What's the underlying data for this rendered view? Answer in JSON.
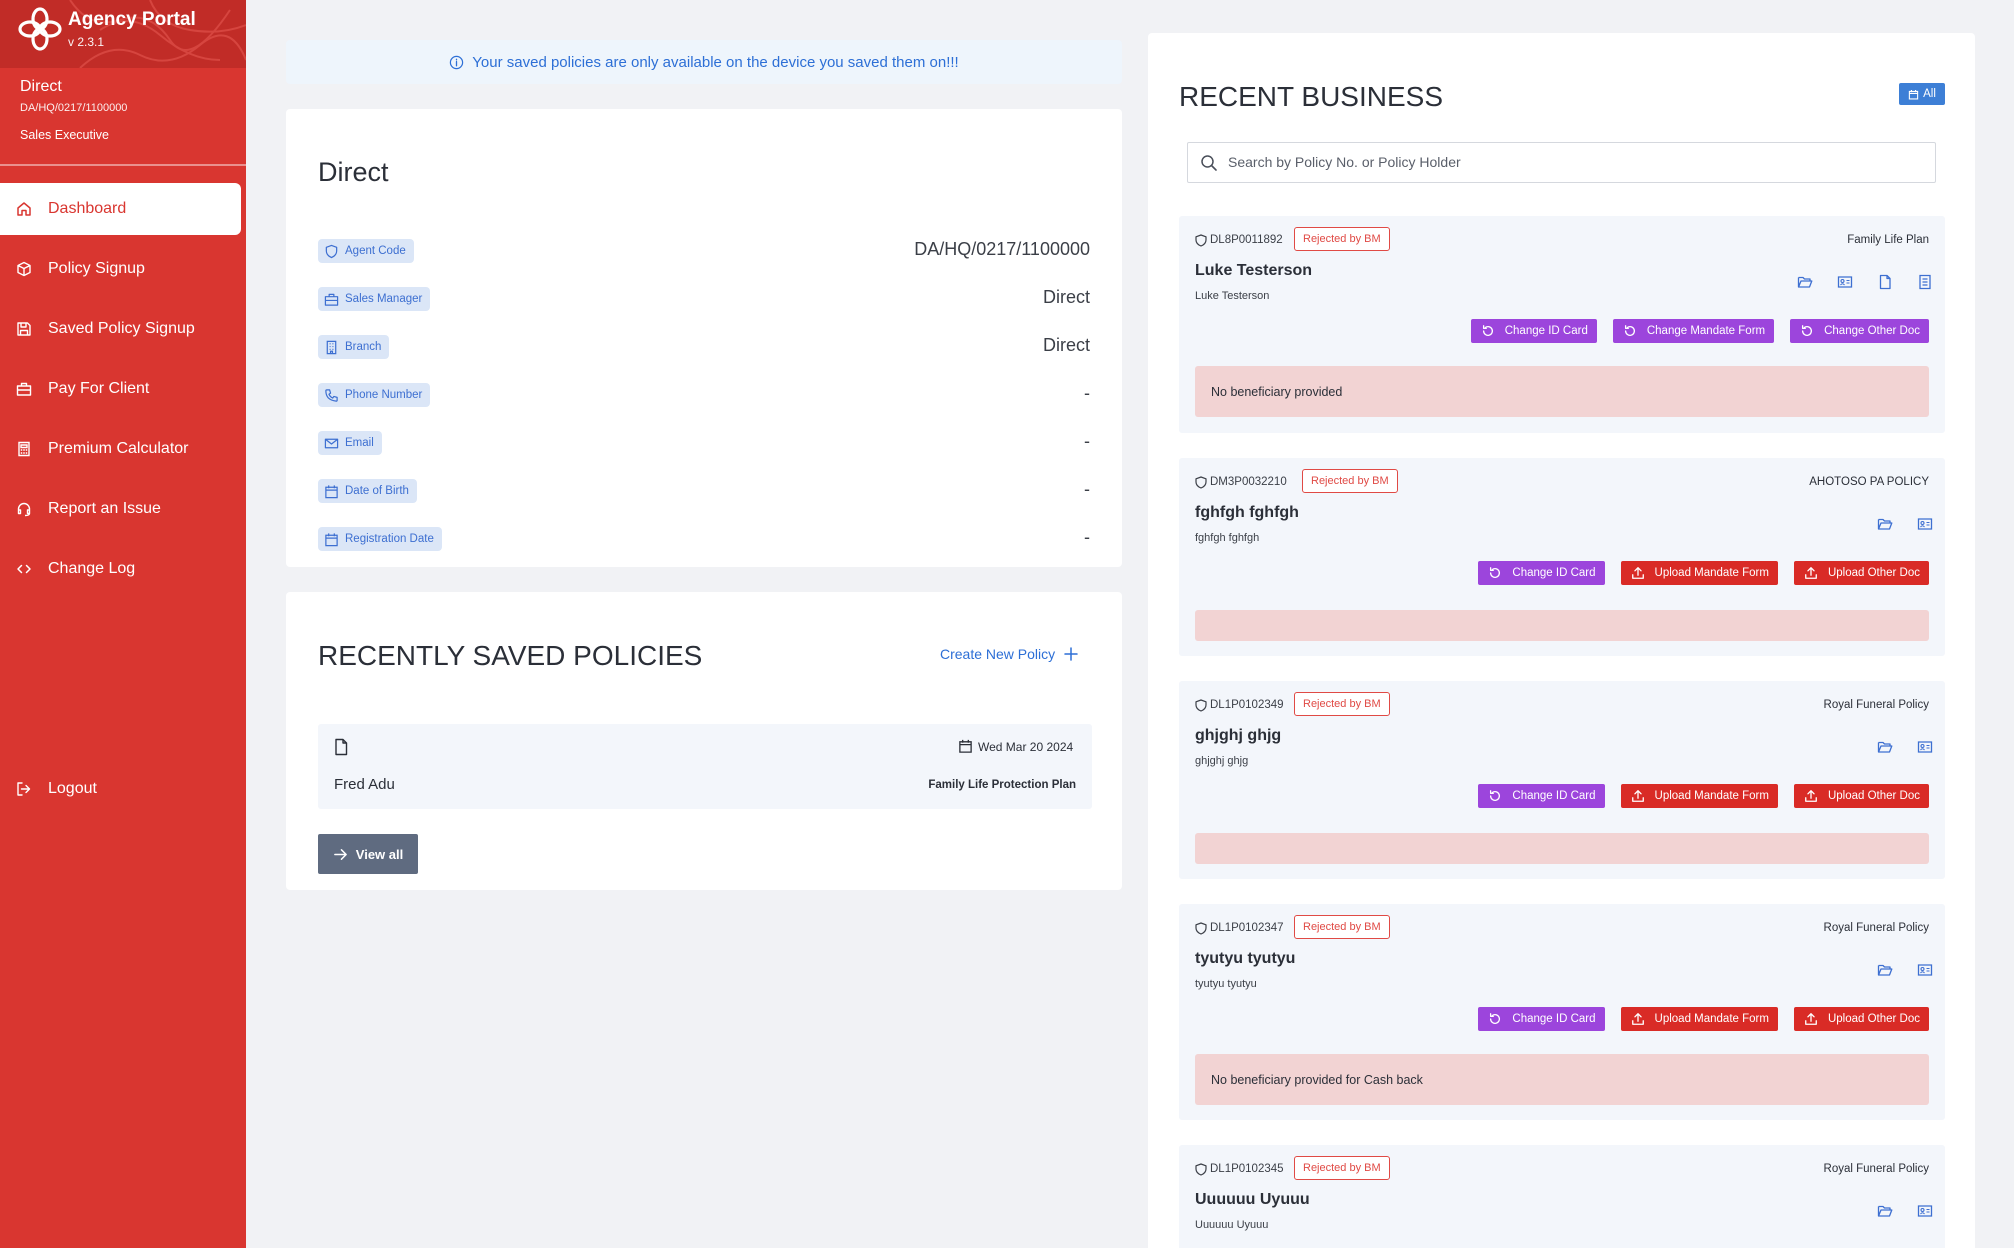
{
  "app": {
    "title": "Agency Portal",
    "version": "v 2.3.1"
  },
  "user": {
    "name": "Direct",
    "code": "DA/HQ/0217/1100000",
    "role": "Sales Executive"
  },
  "nav": {
    "items": [
      {
        "label": "Dashboard",
        "icon": "home-icon",
        "active": true
      },
      {
        "label": "Policy Signup",
        "icon": "package-icon"
      },
      {
        "label": "Saved Policy Signup",
        "icon": "save-icon"
      },
      {
        "label": "Pay For Client",
        "icon": "briefcase-icon"
      },
      {
        "label": "Premium Calculator",
        "icon": "calculator-icon"
      },
      {
        "label": "Report an Issue",
        "icon": "headset-icon"
      },
      {
        "label": "Change Log",
        "icon": "code-icon"
      }
    ],
    "logout": "Logout"
  },
  "notice": "Your saved policies are only available on the device you saved them on!!!",
  "profile": {
    "title": "Direct",
    "rows": [
      {
        "label": "Agent Code",
        "value": "DA/HQ/0217/1100000",
        "icon": "shield-icon"
      },
      {
        "label": "Sales Manager",
        "value": "Direct",
        "icon": "briefcase-icon"
      },
      {
        "label": "Branch",
        "value": "Direct",
        "icon": "building-icon"
      },
      {
        "label": "Phone Number",
        "value": "-",
        "icon": "phone-icon"
      },
      {
        "label": "Email",
        "value": "-",
        "icon": "mail-icon"
      },
      {
        "label": "Date of Birth",
        "value": "-",
        "icon": "calendar-icon"
      },
      {
        "label": "Registration Date",
        "value": "-",
        "icon": "calendar-icon"
      }
    ]
  },
  "saved": {
    "title": "RECENTLY SAVED POLICIES",
    "create_label": "Create New Policy",
    "item": {
      "date": "Wed Mar 20 2024",
      "name": "Fred Adu",
      "plan": "Family Life Protection Plan"
    },
    "view_all": "View all"
  },
  "recent": {
    "title": "RECENT BUSINESS",
    "all_label": "All",
    "search_placeholder": "Search by Policy No. or Policy Holder",
    "items": [
      {
        "policy_no": "DL8P0011892",
        "status": "Rejected by BM",
        "type": "Family Life Plan",
        "holder": "Luke Testerson",
        "sub": "Luke Testerson",
        "actions": [
          "Change ID Card",
          "Change Mandate Form",
          "Change Other Doc"
        ],
        "note": "No beneficiary provided"
      },
      {
        "policy_no": "DM3P0032210",
        "status": "Rejected by BM",
        "type": "AHOTOSO PA POLICY",
        "holder": "fghfgh fghfgh",
        "sub": "fghfgh fghfgh",
        "actions": [
          "Change ID Card",
          "Upload Mandate Form",
          "Upload Other Doc"
        ],
        "note": ""
      },
      {
        "policy_no": "DL1P0102349",
        "status": "Rejected by BM",
        "type": "Royal Funeral Policy",
        "holder": "ghjghj ghjg",
        "sub": "ghjghj ghjg",
        "actions": [
          "Change ID Card",
          "Upload Mandate Form",
          "Upload Other Doc"
        ],
        "note": ""
      },
      {
        "policy_no": "DL1P0102347",
        "status": "Rejected by BM",
        "type": "Royal Funeral Policy",
        "holder": "tyutyu tyutyu",
        "sub": "tyutyu tyutyu",
        "actions": [
          "Change ID Card",
          "Upload Mandate Form",
          "Upload Other Doc"
        ],
        "note": "No beneficiary provided for Cash back"
      },
      {
        "policy_no": "DL1P0102345",
        "status": "Rejected by BM",
        "type": "Royal Funeral Policy",
        "holder": "Uuuuuu Uyuuu",
        "sub": "Uuuuuu Uyuuu",
        "actions": [],
        "note": ""
      }
    ]
  },
  "colors": {
    "brand_red": "#d93630",
    "accent_blue": "#2d6fd6",
    "action_purple": "#9c45dc",
    "action_red": "#d92b26"
  }
}
